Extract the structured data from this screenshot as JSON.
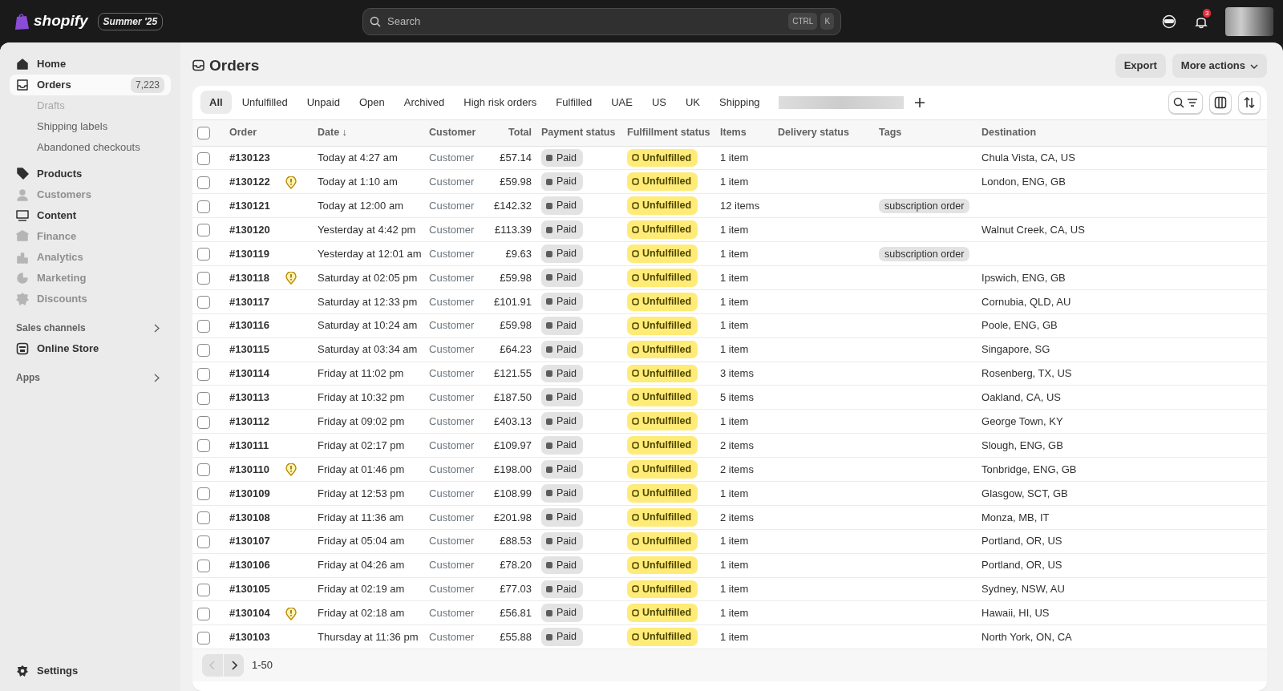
{
  "topbar": {
    "logo_text": "shopify",
    "edition": "Summer '25",
    "search": {
      "placeholder": "Search",
      "keys": [
        "CTRL",
        "K"
      ]
    },
    "notification_count": "3"
  },
  "sidebar": {
    "items": [
      {
        "label": "Home",
        "selected": false,
        "disabled": false
      },
      {
        "label": "Orders",
        "selected": true,
        "disabled": false,
        "count": "7,223",
        "children": [
          {
            "label": "Drafts",
            "disabled": true
          },
          {
            "label": "Shipping labels",
            "disabled": false
          },
          {
            "label": "Abandoned checkouts",
            "disabled": false
          }
        ]
      },
      {
        "label": "Products",
        "selected": false,
        "disabled": false
      },
      {
        "label": "Customers",
        "selected": false,
        "disabled": true
      },
      {
        "label": "Content",
        "selected": false,
        "disabled": false
      },
      {
        "label": "Finance",
        "selected": false,
        "disabled": true
      },
      {
        "label": "Analytics",
        "selected": false,
        "disabled": true
      },
      {
        "label": "Marketing",
        "selected": false,
        "disabled": true
      },
      {
        "label": "Discounts",
        "selected": false,
        "disabled": true
      }
    ],
    "sections": [
      {
        "label": "Sales channels",
        "items": [
          {
            "label": "Online Store"
          }
        ]
      },
      {
        "label": "Apps"
      }
    ],
    "settings": "Settings"
  },
  "page": {
    "title": "Orders",
    "actions": [
      "Export",
      "More actions"
    ]
  },
  "tabs": [
    {
      "label": "All",
      "selected": true
    },
    {
      "label": "Unfulfilled",
      "selected": false
    },
    {
      "label": "Unpaid",
      "selected": false
    },
    {
      "label": "Open",
      "selected": false
    },
    {
      "label": "Archived",
      "selected": false
    },
    {
      "label": "High risk orders",
      "selected": false
    },
    {
      "label": "Fulfilled",
      "selected": false
    },
    {
      "label": "UAE",
      "selected": false
    },
    {
      "label": "US",
      "selected": false
    },
    {
      "label": "UK",
      "selected": false
    },
    {
      "label": "Shipping",
      "selected": false
    }
  ],
  "table": {
    "select_all_checked": false,
    "columns": [
      "Order",
      "Date ↓",
      "Customer",
      "Total",
      "Payment status",
      "Fulfillment status",
      "Items",
      "Delivery status",
      "Tags",
      "Destination"
    ],
    "rows": [
      {
        "order": "#130123",
        "checked": false,
        "flagged": false,
        "date": "Today at 4:27 am",
        "customer": "Customer",
        "total": "£57.14",
        "payment": "Paid",
        "fulfillment": "Unfulfilled",
        "items": "1 item",
        "destination": "Chula Vista, CA, US"
      },
      {
        "order": "#130122",
        "checked": false,
        "flagged": true,
        "date": "Today at 1:10 am",
        "customer": "Customer",
        "total": "£59.98",
        "payment": "Paid",
        "fulfillment": "Unfulfilled",
        "items": "1 item",
        "destination": "London, ENG, GB"
      },
      {
        "order": "#130121",
        "checked": false,
        "flagged": false,
        "date": "Today at 12:00 am",
        "customer": "Customer",
        "total": "£142.32",
        "payment": "Paid",
        "fulfillment": "Unfulfilled",
        "items": "12 items",
        "tag": "subscription order"
      },
      {
        "order": "#130120",
        "checked": false,
        "flagged": false,
        "date": "Yesterday at 4:42 pm",
        "customer": "Customer",
        "total": "£113.39",
        "payment": "Paid",
        "fulfillment": "Unfulfilled",
        "items": "1 item",
        "destination": "Walnut Creek, CA, US"
      },
      {
        "order": "#130119",
        "checked": false,
        "flagged": false,
        "date": "Yesterday at 12:01 am",
        "customer": "Customer",
        "total": "£9.63",
        "payment": "Paid",
        "fulfillment": "Unfulfilled",
        "items": "1 item",
        "tag": "subscription order"
      },
      {
        "order": "#130118",
        "checked": false,
        "flagged": true,
        "date": "Saturday at 02:05 pm",
        "customer": "Customer",
        "total": "£59.98",
        "payment": "Paid",
        "fulfillment": "Unfulfilled",
        "items": "1 item",
        "destination": "Ipswich, ENG, GB"
      },
      {
        "order": "#130117",
        "checked": false,
        "flagged": false,
        "date": "Saturday at 12:33 pm",
        "customer": "Customer",
        "total": "£101.91",
        "payment": "Paid",
        "fulfillment": "Unfulfilled",
        "items": "1 item",
        "destination": "Cornubia, QLD, AU"
      },
      {
        "order": "#130116",
        "checked": false,
        "flagged": false,
        "date": "Saturday at 10:24 am",
        "customer": "Customer",
        "total": "£59.98",
        "payment": "Paid",
        "fulfillment": "Unfulfilled",
        "items": "1 item",
        "destination": "Poole, ENG, GB"
      },
      {
        "order": "#130115",
        "checked": false,
        "flagged": false,
        "date": "Saturday at 03:34 am",
        "customer": "Customer",
        "total": "£64.23",
        "payment": "Paid",
        "fulfillment": "Unfulfilled",
        "items": "1 item",
        "destination": "Singapore, SG"
      },
      {
        "order": "#130114",
        "checked": false,
        "flagged": false,
        "date": "Friday at 11:02 pm",
        "customer": "Customer",
        "total": "£121.55",
        "payment": "Paid",
        "fulfillment": "Unfulfilled",
        "items": "3 items",
        "destination": "Rosenberg, TX, US"
      },
      {
        "order": "#130113",
        "checked": false,
        "flagged": false,
        "date": "Friday at 10:32 pm",
        "customer": "Customer",
        "total": "£187.50",
        "payment": "Paid",
        "fulfillment": "Unfulfilled",
        "items": "5 items",
        "destination": "Oakland, CA, US"
      },
      {
        "order": "#130112",
        "checked": false,
        "flagged": false,
        "date": "Friday at 09:02 pm",
        "customer": "Customer",
        "total": "£403.13",
        "payment": "Paid",
        "fulfillment": "Unfulfilled",
        "items": "1 item",
        "destination": "George Town, KY"
      },
      {
        "order": "#130111",
        "checked": false,
        "flagged": false,
        "date": "Friday at 02:17 pm",
        "customer": "Customer",
        "total": "£109.97",
        "payment": "Paid",
        "fulfillment": "Unfulfilled",
        "items": "2 items",
        "destination": "Slough, ENG, GB"
      },
      {
        "order": "#130110",
        "checked": false,
        "flagged": true,
        "date": "Friday at 01:46 pm",
        "customer": "Customer",
        "total": "£198.00",
        "payment": "Paid",
        "fulfillment": "Unfulfilled",
        "items": "2 items",
        "destination": "Tonbridge, ENG, GB"
      },
      {
        "order": "#130109",
        "checked": false,
        "flagged": false,
        "date": "Friday at 12:53 pm",
        "customer": "Customer",
        "total": "£108.99",
        "payment": "Paid",
        "fulfillment": "Unfulfilled",
        "items": "1 item",
        "destination": "Glasgow, SCT, GB"
      },
      {
        "order": "#130108",
        "checked": false,
        "flagged": false,
        "date": "Friday at 11:36 am",
        "customer": "Customer",
        "total": "£201.98",
        "payment": "Paid",
        "fulfillment": "Unfulfilled",
        "items": "2 items",
        "destination": "Monza, MB, IT"
      },
      {
        "order": "#130107",
        "checked": false,
        "flagged": false,
        "date": "Friday at 05:04 am",
        "customer": "Customer",
        "total": "£88.53",
        "payment": "Paid",
        "fulfillment": "Unfulfilled",
        "items": "1 item",
        "destination": "Portland, OR, US"
      },
      {
        "order": "#130106",
        "checked": false,
        "flagged": false,
        "date": "Friday at 04:26 am",
        "customer": "Customer",
        "total": "£78.20",
        "payment": "Paid",
        "fulfillment": "Unfulfilled",
        "items": "1 item",
        "destination": "Portland, OR, US"
      },
      {
        "order": "#130105",
        "checked": false,
        "flagged": false,
        "date": "Friday at 02:19 am",
        "customer": "Customer",
        "total": "£77.03",
        "payment": "Paid",
        "fulfillment": "Unfulfilled",
        "items": "1 item",
        "destination": "Sydney, NSW, AU"
      },
      {
        "order": "#130104",
        "checked": false,
        "flagged": true,
        "date": "Friday at 02:18 am",
        "customer": "Customer",
        "total": "£56.81",
        "payment": "Paid",
        "fulfillment": "Unfulfilled",
        "items": "1 item",
        "destination": "Hawaii, HI, US"
      },
      {
        "order": "#130103",
        "checked": false,
        "flagged": false,
        "date": "Thursday at 11:36 pm",
        "customer": "Customer",
        "total": "£55.88",
        "payment": "Paid",
        "fulfillment": "Unfulfilled",
        "items": "1 item",
        "destination": "North York, ON, CA"
      }
    ]
  },
  "pagination": {
    "range": "1-50",
    "previous_disabled": true
  }
}
